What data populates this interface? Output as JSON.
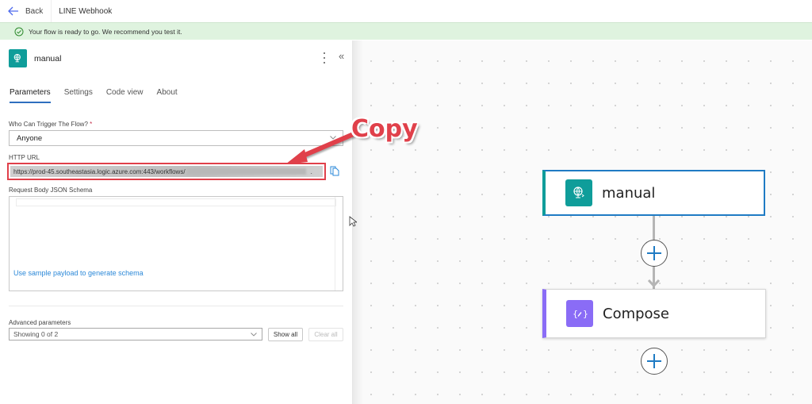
{
  "topbar": {
    "back_label": "Back",
    "title": "LINE Webhook"
  },
  "banner": {
    "message": "Your flow is ready to go. We recommend you test it."
  },
  "panel": {
    "node_name": "manual",
    "tabs": [
      {
        "label": "Parameters",
        "active": true
      },
      {
        "label": "Settings",
        "active": false
      },
      {
        "label": "Code view",
        "active": false
      },
      {
        "label": "About",
        "active": false
      }
    ],
    "who_can_trigger": {
      "label": "Who Can Trigger The Flow?",
      "required_marker": "*",
      "value": "Anyone"
    },
    "http_url": {
      "label": "HTTP URL",
      "value": "https://prod-45.southeastasia.logic.azure.com:443/workflows/",
      "trailing": "."
    },
    "request_schema": {
      "label": "Request Body JSON Schema",
      "link": "Use sample payload to generate schema"
    },
    "advanced": {
      "label": "Advanced parameters",
      "value": "Showing 0 of 2",
      "show_all": "Show all",
      "clear_all": "Clear all"
    }
  },
  "annotation": {
    "callout_text": "Copy",
    "color": "#e0404a"
  },
  "canvas": {
    "nodes": [
      {
        "label": "manual",
        "type": "trigger",
        "color": "#0f9d9a"
      },
      {
        "label": "Compose",
        "type": "action",
        "color": "#8a6cf6"
      }
    ]
  }
}
